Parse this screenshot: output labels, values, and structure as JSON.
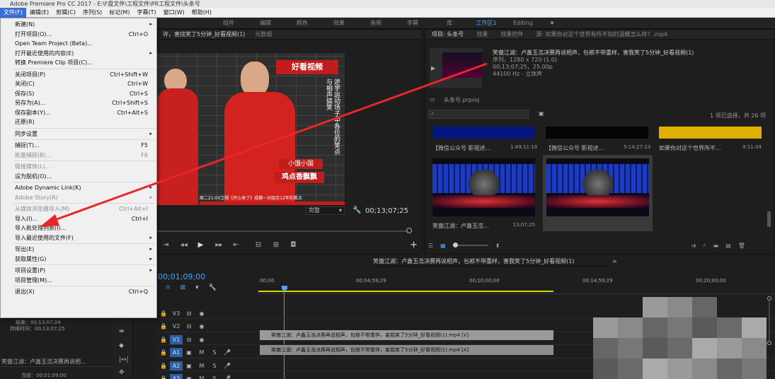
{
  "app": {
    "title": "Adobe Premiere Pro CC 2017 - E:\\F盘文件\\工程文件\\PR工程文件\\头条号"
  },
  "menubar": [
    "文件(F)",
    "编辑(E)",
    "剪辑(C)",
    "序列(S)",
    "标记(M)",
    "字幕(T)",
    "窗口(W)",
    "帮助(H)"
  ],
  "workspaces": [
    "组件",
    "编辑",
    "颜色",
    "效果",
    "音频",
    "字幕",
    "库",
    "工作区1",
    "Editing"
  ],
  "file_menu": [
    {
      "label": "新建(N)",
      "shortcut": "",
      "arrow": true,
      "disabled": false
    },
    {
      "label": "打开项目(O)...",
      "shortcut": "Ctrl+O",
      "arrow": false,
      "disabled": false
    },
    {
      "label": "Open Team Project (Beta)...",
      "shortcut": "",
      "arrow": false,
      "disabled": false
    },
    {
      "label": "打开最近使用的内容(E)",
      "shortcut": "",
      "arrow": true,
      "disabled": false
    },
    {
      "label": "转换 Premiere Clip 项目(C)...",
      "shortcut": "",
      "arrow": false,
      "disabled": false
    },
    {
      "label": "关闭项目(P)",
      "shortcut": "Ctrl+Shift+W",
      "arrow": false,
      "disabled": false
    },
    {
      "label": "关闭(C)",
      "shortcut": "Ctrl+W",
      "arrow": false,
      "disabled": false
    },
    {
      "label": "保存(S)",
      "shortcut": "Ctrl+S",
      "arrow": false,
      "disabled": false
    },
    {
      "label": "另存为(A)...",
      "shortcut": "Ctrl+Shift+S",
      "arrow": false,
      "disabled": false
    },
    {
      "label": "保存副本(Y)...",
      "shortcut": "Ctrl+Alt+S",
      "arrow": false,
      "disabled": false
    },
    {
      "label": "还原(R)",
      "shortcut": "",
      "arrow": false,
      "disabled": false
    },
    {
      "label": "同步设置",
      "shortcut": "",
      "arrow": true,
      "disabled": false
    },
    {
      "label": "捕捉(T)...",
      "shortcut": "F5",
      "arrow": false,
      "disabled": false
    },
    {
      "label": "批量捕捉(B)...",
      "shortcut": "F6",
      "arrow": false,
      "disabled": true
    },
    {
      "label": "链接媒体(L)...",
      "shortcut": "",
      "arrow": false,
      "disabled": true
    },
    {
      "label": "设为脱机(O)...",
      "shortcut": "",
      "arrow": false,
      "disabled": false
    },
    {
      "label": "Adobe Dynamic Link(K)",
      "shortcut": "",
      "arrow": true,
      "disabled": false
    },
    {
      "label": "Adobe Story(R)",
      "shortcut": "",
      "arrow": true,
      "disabled": true
    },
    {
      "label": "从媒体浏览器导入(M)",
      "shortcut": "Ctrl+Alt+I",
      "arrow": false,
      "disabled": true
    },
    {
      "label": "导入(I)...",
      "shortcut": "Ctrl+I",
      "arrow": false,
      "disabled": false
    },
    {
      "label": "导入批处理列表(I)...",
      "shortcut": "",
      "arrow": false,
      "disabled": false
    },
    {
      "label": "导入最近使用的文件(F)",
      "shortcut": "",
      "arrow": true,
      "disabled": false
    },
    {
      "label": "导出(E)",
      "shortcut": "",
      "arrow": true,
      "disabled": false
    },
    {
      "label": "获取属性(G)",
      "shortcut": "",
      "arrow": true,
      "disabled": false
    },
    {
      "label": "项目设置(P)",
      "shortcut": "",
      "arrow": true,
      "disabled": false
    },
    {
      "label": "项目管理(M)...",
      "shortcut": "",
      "arrow": false,
      "disabled": false
    },
    {
      "label": "退出(X)",
      "shortcut": "Ctrl+Q",
      "arrow": false,
      "disabled": false
    }
  ],
  "source_monitor": {
    "tab_clip": "许，害找笑了5分钟_好看视频(1)",
    "tab_meta": "元数据",
    "video_logo": "好看视频",
    "video_vertical": "逆学运动场子中各位的笑点与相声搞笑",
    "video_tag1": "小饿小国",
    "video_tag2": "鸡点香飘飘",
    "video_caption": "周二21:00卫视《开心来了》成都一对组合12年的笑点",
    "fit": "完整",
    "timecode": "00;13;07;25"
  },
  "project": {
    "tabs": [
      "项目: 头条号",
      "效果",
      "效果控件",
      "源: 如果你对这个世界有所不知的温暖怎么样？.mp4"
    ],
    "clip_name": "笑傲江湖：卢鑫玉浩决赛再说相声，包袱不带重样，害我笑了5分钟_好看视频(1)",
    "clip_info1": "序列，1280 x 720 (1.0)",
    "clip_info2": "00;13;07;25，25.00p",
    "clip_info3": "44100 Hz - 立体声",
    "project_file": "头条号.prproj",
    "selection": "1 项已选择，共 26 项",
    "items": [
      {
        "name": "【微信公众号 影视述...",
        "duration": "1:49;11:18"
      },
      {
        "name": "【微信公众号 影视述...",
        "duration": "5:14;27:23"
      },
      {
        "name": "如果你对这个世界所不...",
        "duration": "9:11:04"
      },
      {
        "name": "笑傲江湖：卢鑫玉浩...",
        "duration": "13;07;25"
      },
      {
        "name": "笑傲江湖：卢鑫玉浩...",
        "duration": "13;07;25"
      }
    ]
  },
  "timeline": {
    "tab": "笑傲江湖：卢鑫玉浩决赛再说相声，包袱不带重样，害我笑了5分钟_好看视频(1)",
    "timecode": "00;01;09;00",
    "ruler": [
      ":00;00",
      "00;04;59;29",
      "00;10;00;00",
      "00;14;59;29",
      "00;20;00;00"
    ],
    "tracks": [
      "V3",
      "V2",
      "V1",
      "A1",
      "A2",
      "A3"
    ],
    "clip_video": "笑傲江湖：卢鑫玉浩决赛再说相声，包袱不带重样，害我笑了5分钟_好看视频(1).mp4 [V]",
    "clip_audio": "笑傲江湖：卢鑫玉浩决赛再说相声，包袱不带重样，害我笑了5分钟_好看视频(1).mp4 [A]"
  },
  "left_info": {
    "end": "结束：00;13;07;24",
    "duration": "持续时间：00;13;07;25",
    "clip": "笑傲江湖：卢鑫玉浩决赛再说相...",
    "current": "当前：00;01;09;00"
  },
  "colors": {
    "accent": "#4da0ff",
    "arrow": "#e8262a",
    "menu_active": "#3a6fd8",
    "work_area": "#d8d800"
  }
}
